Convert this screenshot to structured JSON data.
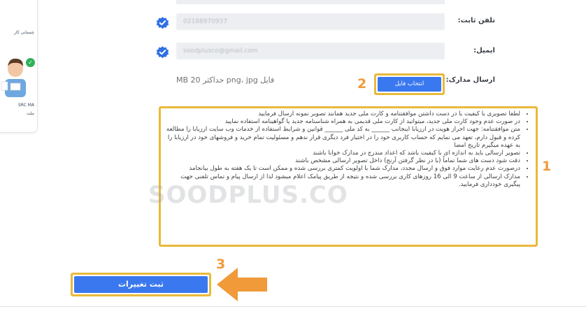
{
  "side_card": {
    "line1": "چسبانی کار",
    "line2": "SRC MA",
    "line3": "ملت"
  },
  "form": {
    "phone": {
      "label": "تلفن ثابت:",
      "value": "02188970937"
    },
    "email": {
      "label": "ایمیل:",
      "value": "soodplusco@gmail.com"
    },
    "documents": {
      "label": "ارسال مدارک:",
      "note": "فایل png، jpg حداکثر MB 20",
      "button_label": "انتخاب فایل"
    }
  },
  "annotations": {
    "step1": "1",
    "step2": "2",
    "step3": "3",
    "highlight_color": "#e9b93a",
    "arrow_color": "#f09a3a"
  },
  "notes": [
    "لطفا تصویری با کیفیت با در دست داشتن موافقتنامه و کارت ملی جدید همانند تصویر نمونه ارسال فرمایید",
    "در صورت عدم وجود کارت ملی جدید، میتوانید از کارت ملی قدیمی به همراه شناسنامه جدید یا گواهینامه استفاده نمایید",
    "متن موافقتنامه: جهت احراز هویت در ارزیابا اینجانب ______ به کد ملی ______ قوانین و شرایط استفاده از خدمات وب سایت ارزیابا را مطالعه کرده و قبول دارم، تعهد می نمایم که حساب کاربری خود را در اختیار فرد دیگری قرار ندهم و مسئولیت تمام خرید و فروشهای خود در ارزیابا را به عهده میگیرم تاریخ امضا",
    "تصویر ارسالی باید به اندازه ای با کیفیت باشد که اعداد مندرج در مدارک خوانا باشند",
    "دقت شود دست های شما تماماً (با در نظر گرفتن آرنج) داخل تصویر ارسالی مشخص باشند",
    "درصورت عدم رعایت موارد فوق و ارسال مجدد، مدارک شما با اولویت کمتری بررسی شده و ممکن است تا یک هفته به طول بیانجامد",
    "مدارک ارسالی از ساعت 9 الی 16 روزهای کاری بررسی شده و نتیجه از طریق پیامک اعلام میشود لذا از ارسال پیام و تماس تلفنی جهت پیگیری خودداری فرمایید."
  ],
  "watermark": "SOODPLUS.CO",
  "submit": {
    "label": "ثبت تغییرات"
  },
  "colors": {
    "accent": "#3a78ef",
    "verified": "#2f6fe4"
  },
  "icons": {
    "verified": "verified-badge-icon",
    "arrow": "arrow-left-icon"
  }
}
